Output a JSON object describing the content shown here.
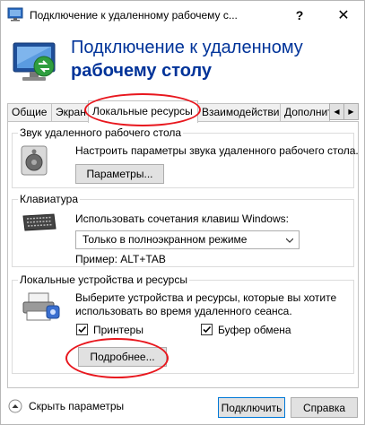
{
  "window": {
    "title": "Подключение к удаленному рабочему с...",
    "help_button": "?",
    "close_button": "✕"
  },
  "banner": {
    "line1": "Подключение к удаленному",
    "line2": "рабочему столу"
  },
  "tabs": [
    {
      "label": "Общие"
    },
    {
      "label": "Экран"
    },
    {
      "label": "Локальные ресурсы"
    },
    {
      "label": "Взаимодействие"
    },
    {
      "label": "Дополнит"
    }
  ],
  "tab_scroll": {
    "left": "◀",
    "right": "▶"
  },
  "sound_group": {
    "title": "Звук удаленного рабочего стола",
    "description": "Настроить параметры звука удаленного рабочего стола.",
    "button": "Параметры..."
  },
  "keyboard_group": {
    "title": "Клавиатура",
    "description": "Использовать сочетания клавиш Windows:",
    "selected_option": "Только в полноэкранном режиме",
    "example": "Пример: ALT+TAB"
  },
  "devices_group": {
    "title": "Локальные устройства и ресурсы",
    "description_line1": "Выберите устройства и ресурсы, которые вы хотите",
    "description_line2": "использовать во время удаленного сеанса.",
    "printers_label": "Принтеры",
    "printers_checked": true,
    "clipboard_label": "Буфер обмена",
    "clipboard_checked": true,
    "details_button": "Подробнее..."
  },
  "footer": {
    "hide_options": "Скрыть параметры",
    "connect_button": "Подключить",
    "help_button": "Справка"
  },
  "colors": {
    "banner_text": "#003399",
    "annotation": "#e8171e",
    "focus": "#0078d7"
  }
}
